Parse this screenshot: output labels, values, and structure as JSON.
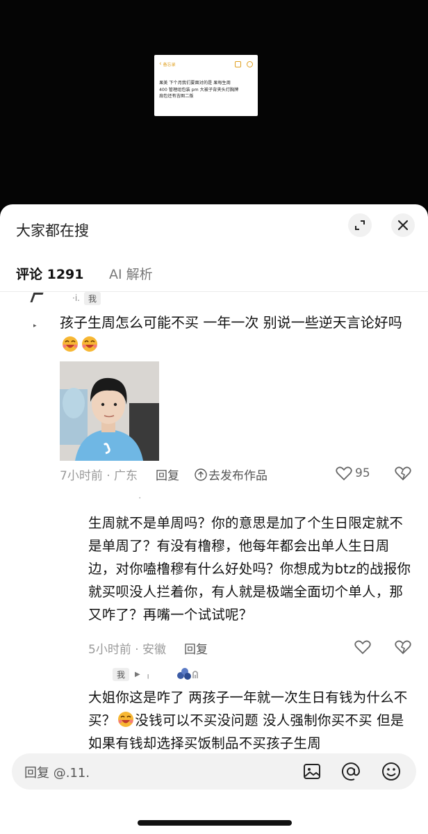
{
  "memo": {
    "back_label": "备忘录",
    "line1": "果美 下个月我们要面对的是 果每生周",
    "line2": "400 管理组包装 pm 大被子背夹头灯胸牌",
    "line3": "扇包还有吉图二版"
  },
  "sheet": {
    "title": "大家都在搜"
  },
  "tabs": [
    {
      "label": "评论 1291"
    },
    {
      "label": "AI 解析"
    }
  ],
  "comment1": {
    "badge": "我",
    "name_fragment": "·i.",
    "text": "孩子生周怎么可能不买 一年一次 别说一些逆天言论好吗",
    "time_location": "7小时前 · 广东",
    "reply": "回复",
    "publish": "去发布作品",
    "likes": "95"
  },
  "comment2": {
    "text": "生周就不是单周吗？你的意思是加了个生日限定就不是单周了？有没有橹穆，他每年都会出单人生日周边，对你嗑橹穆有什么好处吗？你想成为btz的战报你就买呗没人拦着你，有人就是极端全面切个单人，那又咋了？再嘴一个试试呢？",
    "time_location": "5小时前 · 安徽",
    "reply": "回复"
  },
  "comment3": {
    "badge": "我",
    "text_a": "大姐你这是咋了 两孩子一年就一次生日有钱为什么不买？",
    "text_b": "没钱可以不买没问题 没人强制你买不买 但是如果有钱却选择买饭制品不买孩子生周"
  },
  "input": {
    "placeholder": "回复 @.11."
  },
  "colors": {
    "sheet_bg": "#ffffff",
    "video_bg": "#050505",
    "text_primary": "#111111",
    "text_secondary": "#999999",
    "memo_accent": "#e0a020"
  }
}
